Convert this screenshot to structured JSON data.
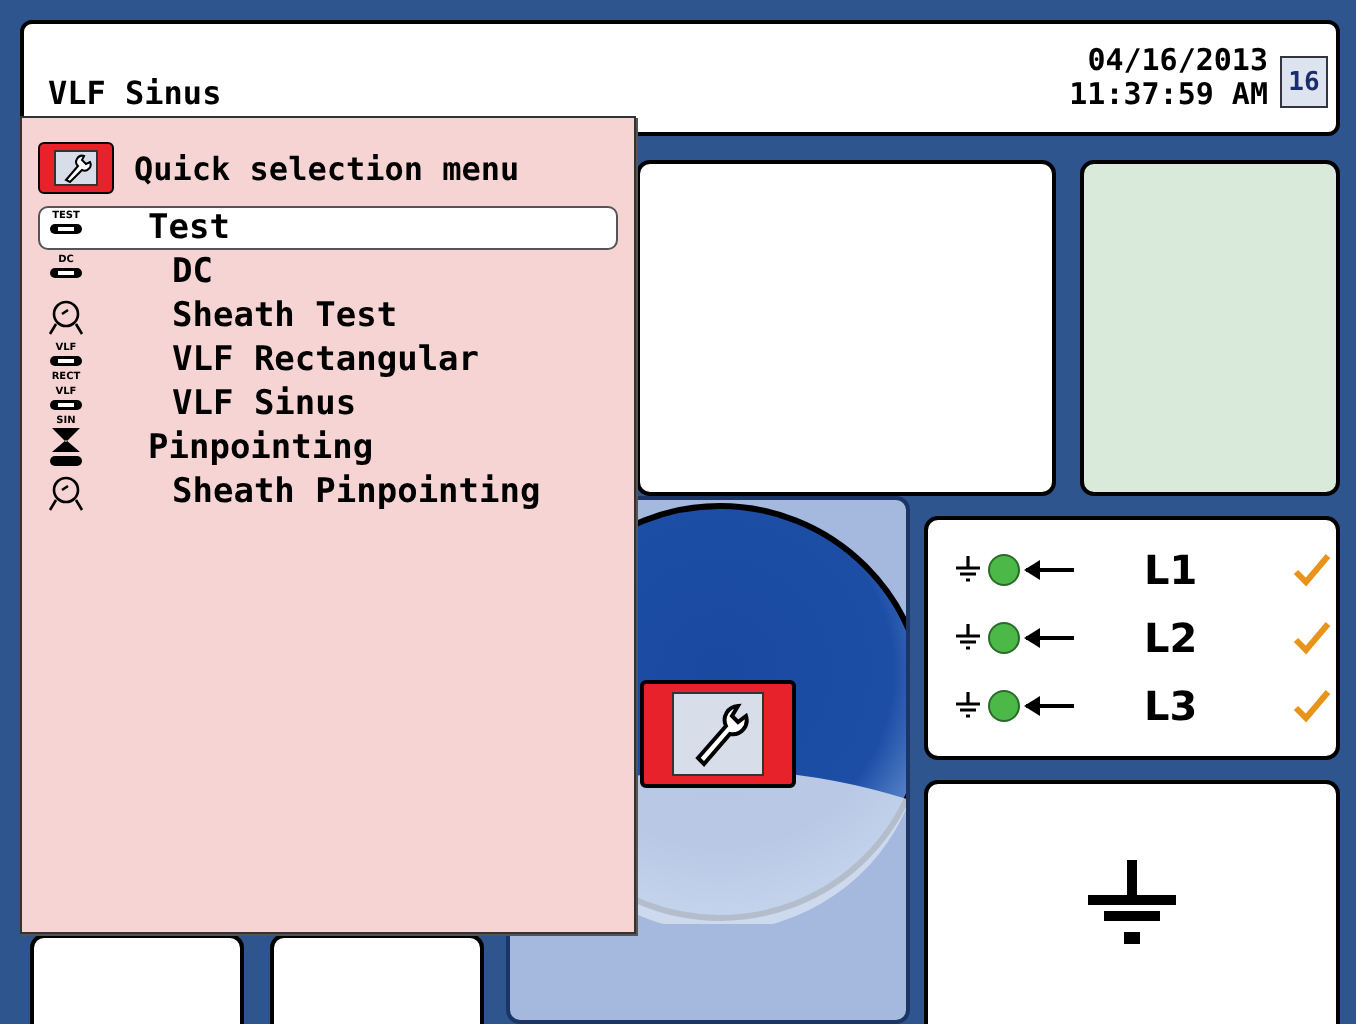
{
  "header": {
    "title": "VLF Sinus",
    "date": "04/16/2013",
    "time": "11:37:59 AM",
    "calendar_day": "16"
  },
  "menu": {
    "title": "Quick selection menu",
    "items": [
      {
        "label": "Test",
        "selected": true,
        "icon_text": [
          "TEST"
        ],
        "children": [
          {
            "label": "DC",
            "selected": false,
            "icon_text": [
              "DC"
            ]
          },
          {
            "label": "Sheath Test",
            "selected": false
          },
          {
            "label": "VLF Rectangular",
            "selected": false,
            "icon_text": [
              "VLF",
              "RECT"
            ]
          },
          {
            "label": "VLF Sinus",
            "selected": false,
            "icon_text": [
              "VLF",
              "SIN"
            ]
          }
        ]
      },
      {
        "label": "Pinpointing",
        "selected": false,
        "children": [
          {
            "label": "Sheath Pinpointing",
            "selected": false
          }
        ]
      }
    ]
  },
  "phases": [
    {
      "label": "L1",
      "color": "#4cb848",
      "ok": true
    },
    {
      "label": "L2",
      "color": "#4cb848",
      "ok": true
    },
    {
      "label": "L3",
      "color": "#4cb848",
      "ok": true
    }
  ]
}
